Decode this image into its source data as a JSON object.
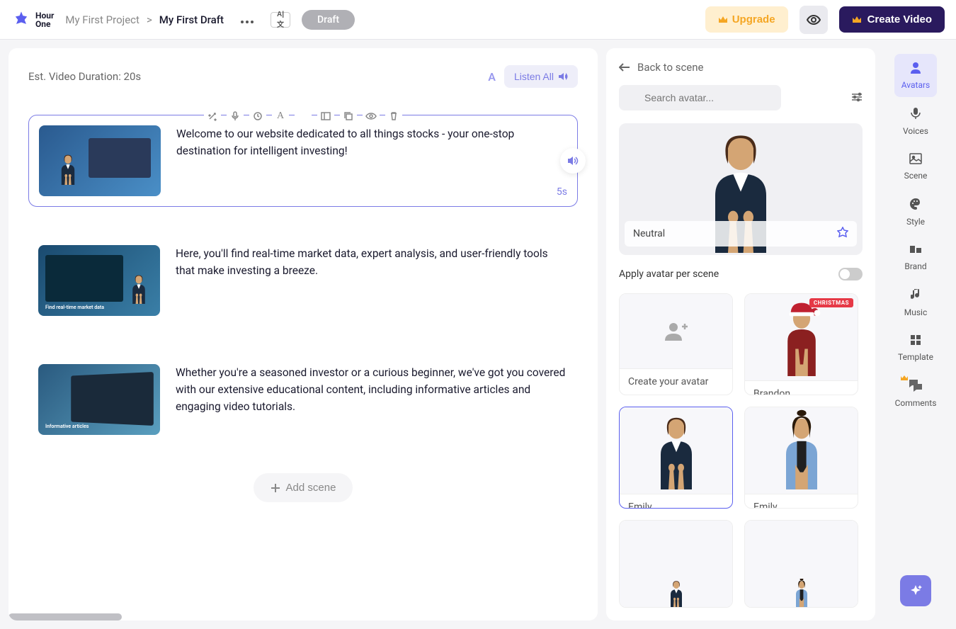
{
  "header": {
    "logo_text_1": "Hour",
    "logo_text_2": "One",
    "breadcrumb_project": "My First Project",
    "breadcrumb_sep": ">",
    "breadcrumb_draft": "My First Draft",
    "draft_label": "Draft",
    "upgrade_label": "Upgrade",
    "create_video_label": "Create Video",
    "lang_label": "A|文"
  },
  "left": {
    "duration": "Est. Video Duration: 20s",
    "listen_all": "Listen All",
    "scenes": [
      {
        "text": "Welcome to our website dedicated to all things stocks - your one-stop destination for intelligent investing!",
        "duration": "5s",
        "caption": ""
      },
      {
        "text": "Here, you'll find real-time market data, expert analysis, and user-friendly tools that make investing a breeze.",
        "caption": "Find real-time market data"
      },
      {
        "text": "Whether you're a seasoned investor or a curious beginner, we've got you covered with our extensive educational content, including informative articles and engaging video tutorials.",
        "caption": "Informative articles"
      }
    ],
    "add_scene": "Add scene"
  },
  "right": {
    "back": "Back to scene",
    "search_placeholder": "Search avatar...",
    "preview_label": "Neutral",
    "apply_label": "Apply avatar per scene",
    "avatars": {
      "create": "Create your avatar",
      "brandon": "Brandon",
      "christmas": "CHRISTMAS",
      "emily1": "Emily",
      "emily2": "Emily"
    }
  },
  "rail": {
    "avatars": "Avatars",
    "voices": "Voices",
    "scene": "Scene",
    "style": "Style",
    "brand": "Brand",
    "music": "Music",
    "template": "Template",
    "comments": "Comments"
  }
}
